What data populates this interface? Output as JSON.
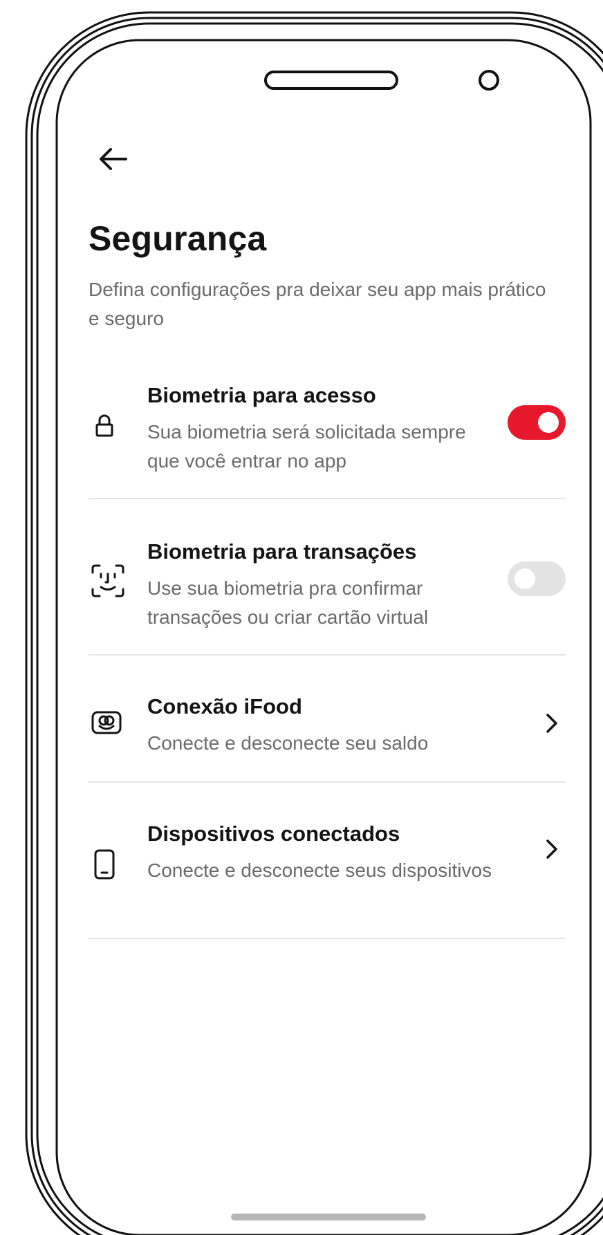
{
  "header": {
    "title": "Segurança",
    "subtitle": "Defina configurações pra deixar seu app mais prático e seguro"
  },
  "settings": [
    {
      "icon": "lock-icon",
      "label": "Biometria para acesso",
      "description": "Sua biometria será solicitada sempre que você entrar no app",
      "control": "toggle",
      "enabled": true
    },
    {
      "icon": "face-id-icon",
      "label": "Biometria para transações",
      "description": "Use sua biometria pra confirmar transações ou criar cartão virtual",
      "control": "toggle",
      "enabled": false
    },
    {
      "icon": "ifood-connection-icon",
      "label": "Conexão iFood",
      "description": "Conecte e desconecte seu saldo",
      "control": "chevron"
    },
    {
      "icon": "smartphone-icon",
      "label": "Dispositivos conectados",
      "description": "Conecte e desconecte seus dispositivos",
      "control": "chevron"
    }
  ],
  "colors": {
    "toggle_on": "#e8182c",
    "toggle_off": "#e3e3e3",
    "title": "#141414",
    "secondary_text": "#6b6b6b"
  }
}
